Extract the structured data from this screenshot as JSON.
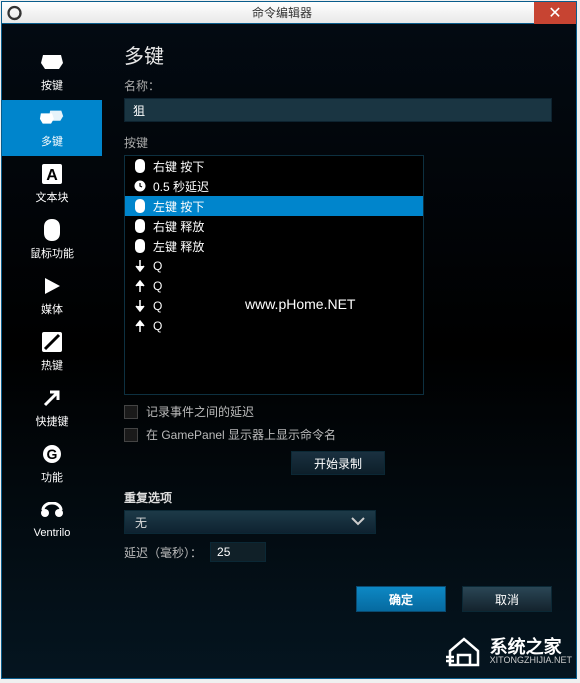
{
  "titlebar": {
    "title": "命令编辑器"
  },
  "sidebar": {
    "items": [
      {
        "label": "按键"
      },
      {
        "label": "多键"
      },
      {
        "label": "文本块"
      },
      {
        "label": "鼠标功能"
      },
      {
        "label": "媒体"
      },
      {
        "label": "热键"
      },
      {
        "label": "快捷键"
      },
      {
        "label": "功能"
      },
      {
        "label": "Ventrilo"
      }
    ]
  },
  "main": {
    "title": "多键",
    "name_label": "名称：",
    "name_value": "狙",
    "list_label": "按键",
    "events": [
      {
        "icon": "mouse",
        "text": "右键 按下"
      },
      {
        "icon": "clock",
        "text": "0.5 秒延迟"
      },
      {
        "icon": "mouse",
        "text": "左键 按下"
      },
      {
        "icon": "mouse",
        "text": "右键 释放"
      },
      {
        "icon": "mouse",
        "text": "左键 释放"
      },
      {
        "icon": "down",
        "text": "Q"
      },
      {
        "icon": "up",
        "text": "Q"
      },
      {
        "icon": "down",
        "text": "Q"
      },
      {
        "icon": "up",
        "text": "Q"
      }
    ],
    "selected_index": 2,
    "watermark": "www.pHome.NET",
    "cb1_label": "记录事件之间的延迟",
    "cb2_label": "在 GamePanel 显示器上显示命令名",
    "record_btn": "开始录制",
    "repeat_label": "重复选项",
    "repeat_value": "无",
    "delay_label": "延迟（毫秒）：",
    "delay_value": "25",
    "ok_btn": "确定",
    "cancel_btn": "取消"
  },
  "overlay": {
    "brand": "系统之家",
    "domain": "XITONGZHIJIA.NET"
  }
}
